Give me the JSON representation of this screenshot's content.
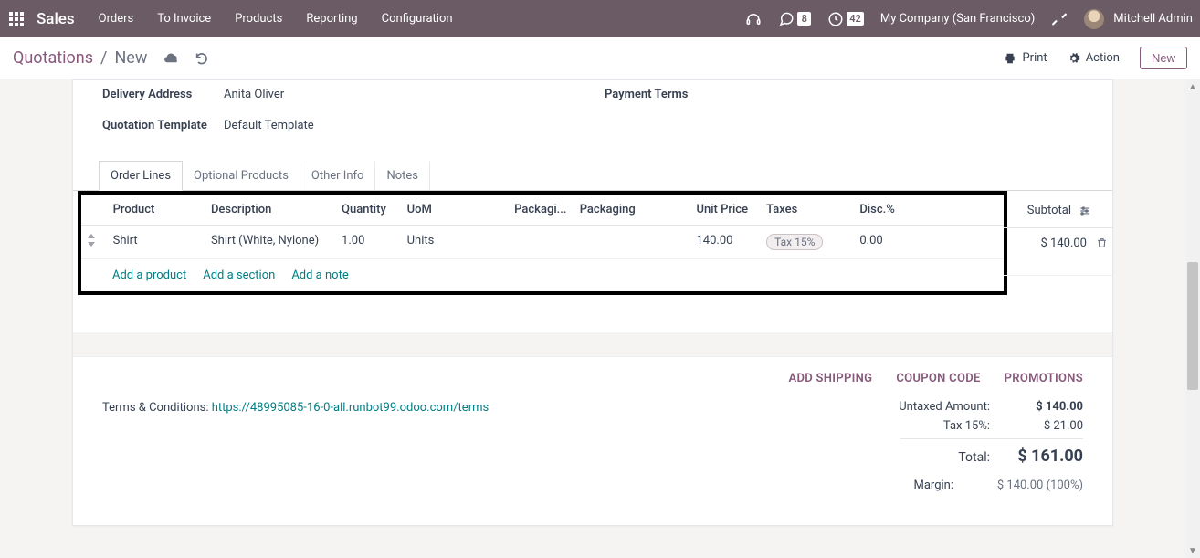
{
  "topbar": {
    "brand": "Sales",
    "nav": [
      "Orders",
      "To Invoice",
      "Products",
      "Reporting",
      "Configuration"
    ],
    "messages_badge": "8",
    "activities_badge": "42",
    "company": "My Company (San Francisco)",
    "user": "Mitchell Admin"
  },
  "breadcrumb": {
    "root": "Quotations",
    "leaf": "New"
  },
  "actions": {
    "print": "Print",
    "action": "Action",
    "new": "New"
  },
  "form": {
    "delivery_address_label": "Delivery Address",
    "delivery_address_value": "Anita Oliver",
    "quotation_template_label": "Quotation Template",
    "quotation_template_value": "Default Template",
    "payment_terms_label": "Payment Terms",
    "payment_terms_value": ""
  },
  "tabs": [
    "Order Lines",
    "Optional Products",
    "Other Info",
    "Notes"
  ],
  "lines": {
    "headers": {
      "product": "Product",
      "description": "Description",
      "quantity": "Quantity",
      "uom": "UoM",
      "packaging_short": "Packagi...",
      "packaging": "Packaging",
      "unit_price": "Unit Price",
      "taxes": "Taxes",
      "disc": "Disc.%",
      "subtotal": "Subtotal"
    },
    "rows": [
      {
        "product": "Shirt",
        "description": "Shirt (White, Nylone)",
        "quantity": "1.00",
        "uom": "Units",
        "packaging_qty": "",
        "packaging": "",
        "unit_price": "140.00",
        "taxes": "Tax 15%",
        "disc": "0.00",
        "subtotal": "$ 140.00"
      }
    ],
    "add_product": "Add a product",
    "add_section": "Add a section",
    "add_note": "Add a note"
  },
  "promos": {
    "shipping": "ADD SHIPPING",
    "coupon": "COUPON CODE",
    "promotions": "PROMOTIONS"
  },
  "terms": {
    "label": "Terms & Conditions: ",
    "link": "https://48995085-16-0-all.runbot99.odoo.com/terms"
  },
  "totals": {
    "untaxed_label": "Untaxed Amount:",
    "untaxed_value": "$ 140.00",
    "tax_label": "Tax 15%:",
    "tax_value": "$ 21.00",
    "total_label": "Total:",
    "total_value": "$ 161.00",
    "margin_label": "Margin:",
    "margin_value": "$ 140.00 (100%)"
  }
}
